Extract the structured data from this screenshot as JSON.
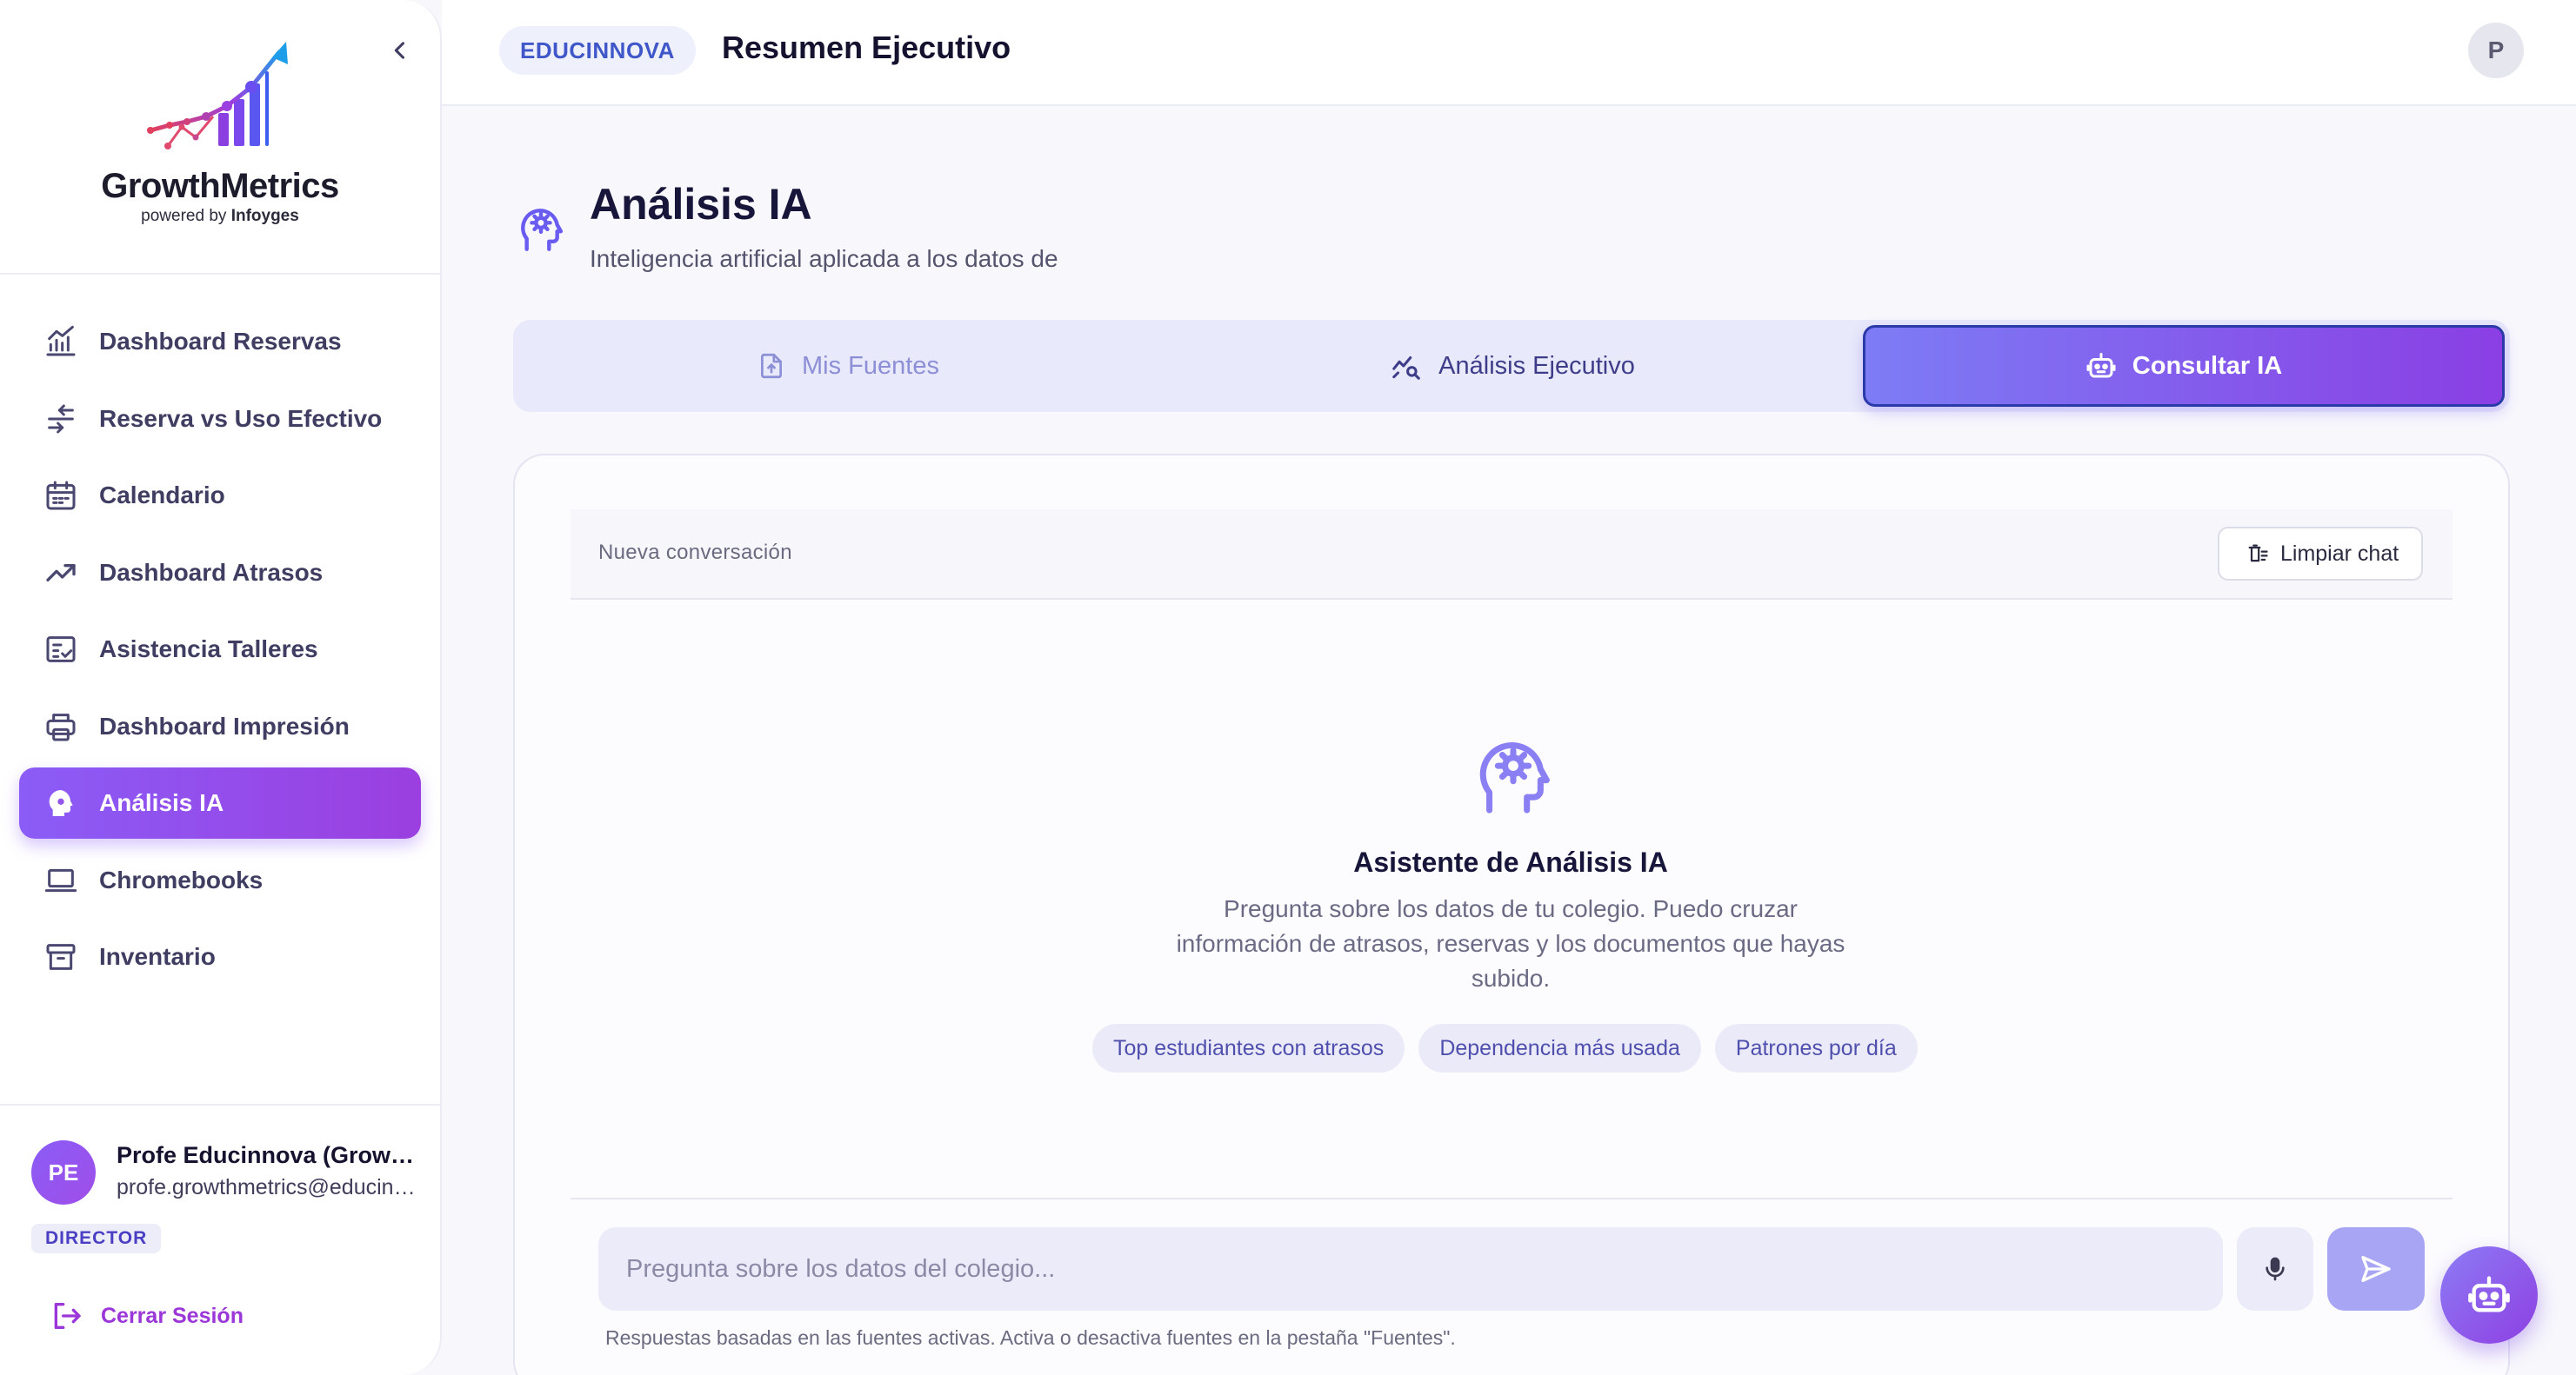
{
  "colors": {
    "accent": "#8b5cf6",
    "accent_end": "#9b3fe0",
    "nav_text": "#3f3d62",
    "heading": "#17153a",
    "muted": "#6b6a85",
    "logout": "#9b36d8"
  },
  "sidebar": {
    "collapse_icon": "chevron-left-icon",
    "logo": {
      "name": "GrowthMetrics",
      "powered_prefix": "powered by",
      "powered_brand": "Infoyges"
    },
    "items": [
      {
        "label": "Dashboard Reservas",
        "icon": "bar-chart-icon",
        "active": false
      },
      {
        "label": "Reserva vs Uso Efectivo",
        "icon": "arrows-compare-icon",
        "active": false
      },
      {
        "label": "Calendario",
        "icon": "calendar-icon",
        "active": false
      },
      {
        "label": "Dashboard Atrasos",
        "icon": "trending-up-icon",
        "active": false
      },
      {
        "label": "Asistencia Talleres",
        "icon": "checklist-icon",
        "active": false
      },
      {
        "label": "Dashboard Impresión",
        "icon": "printer-icon",
        "active": false
      },
      {
        "label": "Análisis IA",
        "icon": "brain-gear-icon",
        "active": true
      },
      {
        "label": "Chromebooks",
        "icon": "laptop-icon",
        "active": false
      },
      {
        "label": "Inventario",
        "icon": "archive-icon",
        "active": false
      }
    ],
    "user": {
      "initials": "PE",
      "name": "Profe Educinnova (GrowthMetrics)",
      "email": "profe.growthmetrics@educinnova.cl",
      "role": "DIRECTOR"
    },
    "logout_label": "Cerrar Sesión"
  },
  "header": {
    "org": "EDUCINNOVA",
    "title": "Resumen Ejecutivo",
    "avatar_initial": "P"
  },
  "page": {
    "title": "Análisis IA",
    "subtitle": "Inteligencia artificial aplicada a los datos de"
  },
  "tabs": [
    {
      "label": "Mis Fuentes",
      "icon": "file-upload-icon",
      "active": false
    },
    {
      "label": "Análisis Ejecutivo",
      "icon": "chart-search-icon",
      "active": false
    },
    {
      "label": "Consultar IA",
      "icon": "robot-icon",
      "active": true
    }
  ],
  "chat": {
    "conversation_label": "Nueva conversación",
    "clear_label": "Limpiar chat",
    "empty_title": "Asistente de Análisis IA",
    "empty_description": "Pregunta sobre los datos de tu colegio. Puedo cruzar información de atrasos, reservas y los documentos que hayas subido.",
    "suggestions": [
      "Top estudiantes con atrasos",
      "Dependencia más usada",
      "Patrones por día"
    ],
    "input_placeholder": "Pregunta sobre los datos del colegio...",
    "footnote": "Respuestas basadas en las fuentes activas. Activa o desactiva fuentes en la pestaña \"Fuentes\"."
  }
}
